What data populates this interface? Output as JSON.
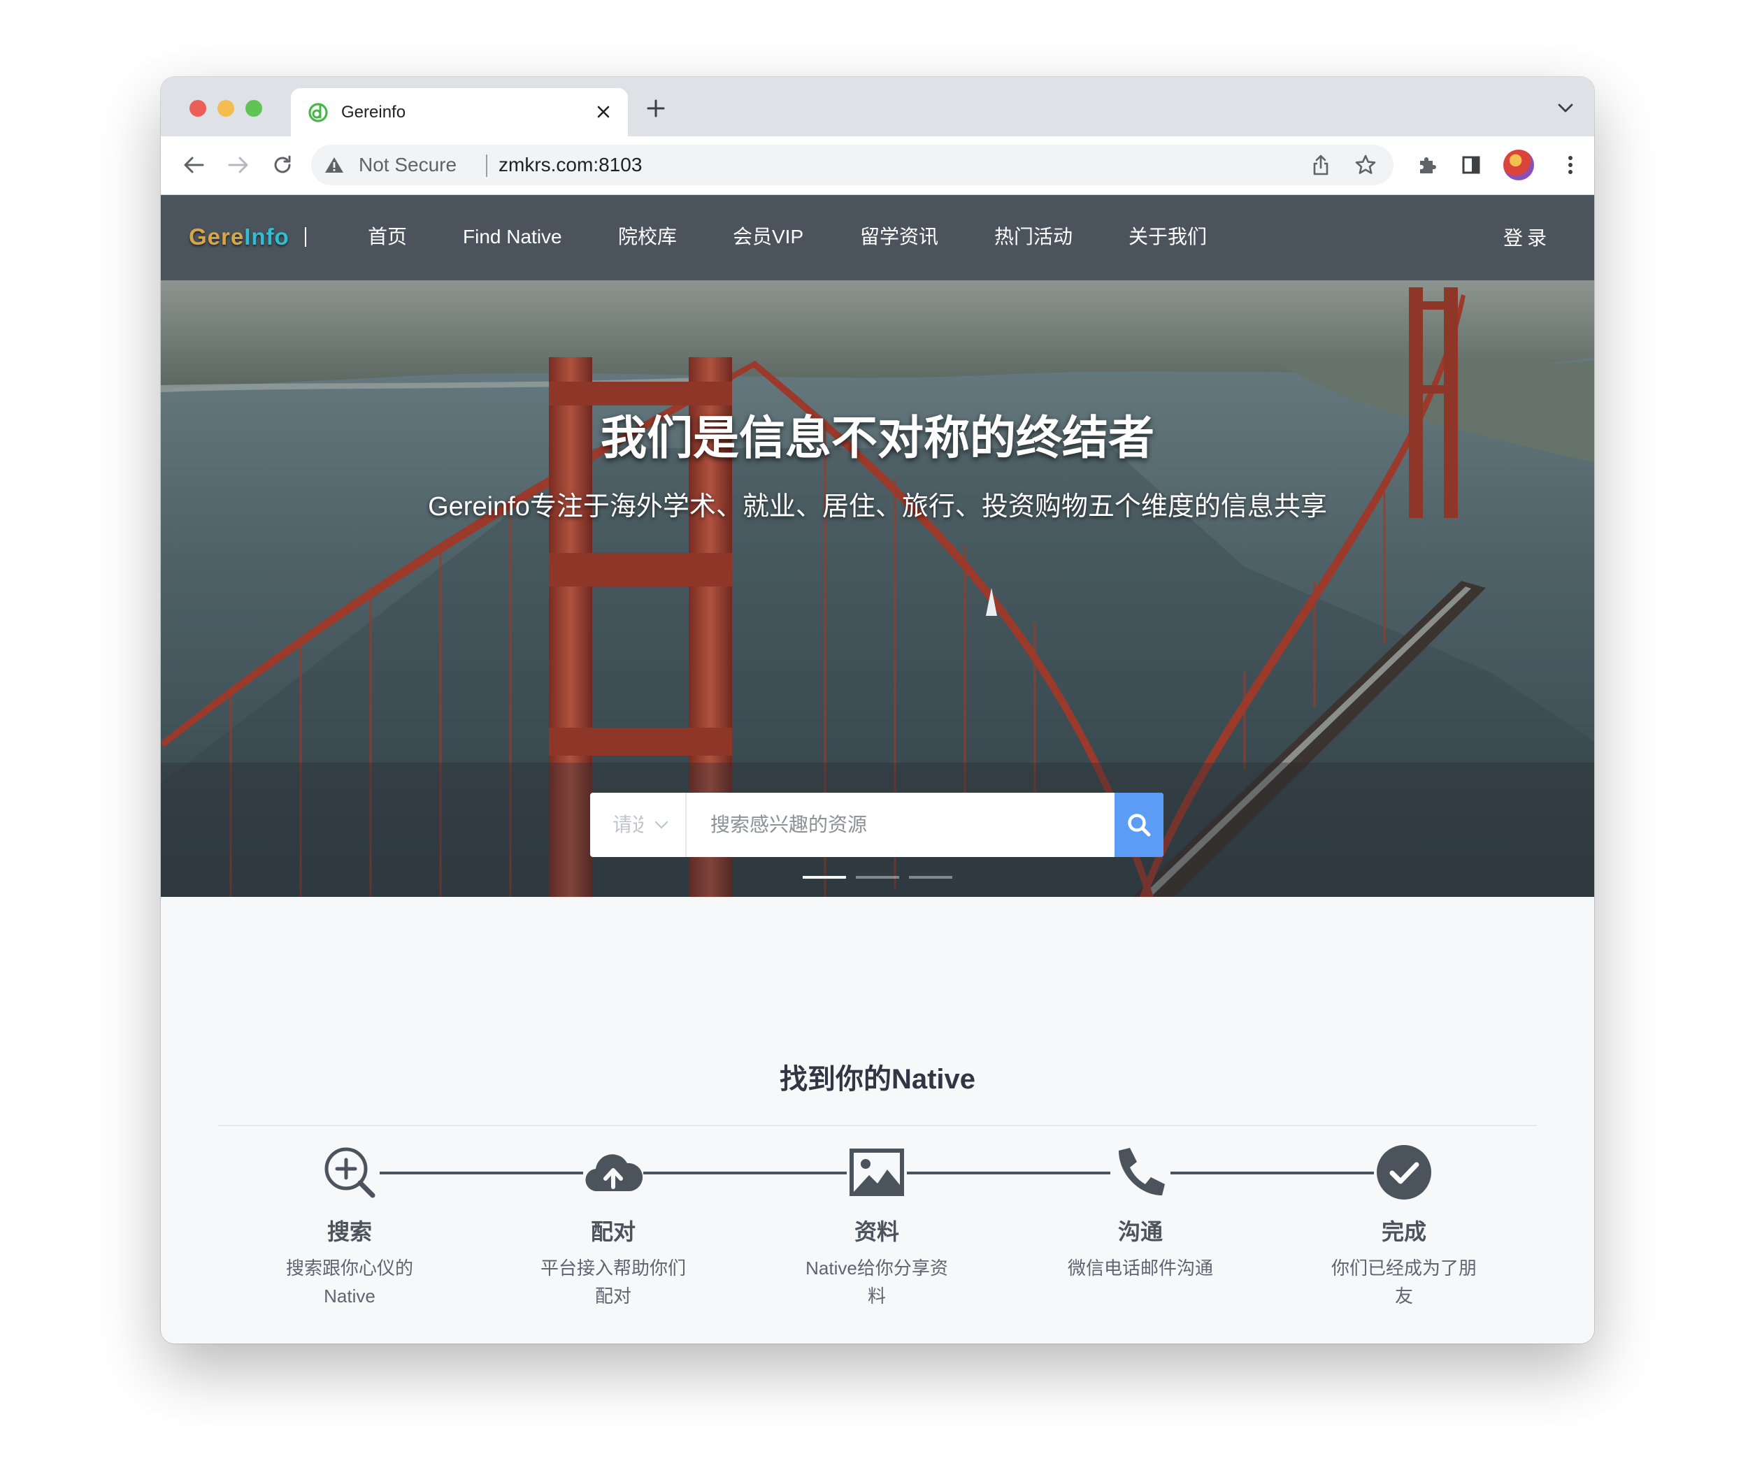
{
  "browser": {
    "tab": {
      "title": "Gereinfo",
      "favicon": "d-letter-favicon"
    },
    "address_bar": {
      "security_label": "Not Secure",
      "url": "zmkrs.com:8103"
    },
    "icons": {
      "back": "arrow-left-icon",
      "forward": "arrow-right-icon",
      "reload": "reload-icon",
      "share": "share-icon",
      "bookmark": "star-icon",
      "extensions": "puzzle-icon",
      "side_panel": "side-panel-icon",
      "menu": "kebab-menu-icon"
    }
  },
  "site": {
    "logo": {
      "part1": "Gere",
      "part2": "Info"
    },
    "nav": [
      "首页",
      "Find Native",
      "院校库",
      "会员VIP",
      "留学资讯",
      "热门活动",
      "关于我们"
    ],
    "login": "登录",
    "brand_colors": {
      "nav_bg": "#4b535c",
      "accent_blue": "#5b9cf6",
      "logo_gold": "#d6a64b",
      "logo_cyan": "#2fbfd4"
    }
  },
  "hero": {
    "title": "我们是信息不对称的终结者",
    "subtitle": "Gereinfo专注于海外学术、就业、居住、旅行、投资购物五个维度的信息共享",
    "search": {
      "select_placeholder": "请选择",
      "input_placeholder": "搜索感兴趣的资源",
      "button_icon": "search-icon"
    },
    "carousel": {
      "slides": 3,
      "active_index": 0
    }
  },
  "steps_section": {
    "title": "找到你的Native",
    "steps": [
      {
        "icon": "zoom-in-icon",
        "title": "搜索",
        "desc": "搜索跟你心仪的Native"
      },
      {
        "icon": "cloud-upload-icon",
        "title": "配对",
        "desc": "平台接入帮助你们配对"
      },
      {
        "icon": "image-icon",
        "title": "资料",
        "desc": "Native给你分享资料"
      },
      {
        "icon": "phone-icon",
        "title": "沟通",
        "desc": "微信电话邮件沟通"
      },
      {
        "icon": "check-circle-icon",
        "title": "完成",
        "desc": "你们已经成为了朋友"
      }
    ]
  }
}
